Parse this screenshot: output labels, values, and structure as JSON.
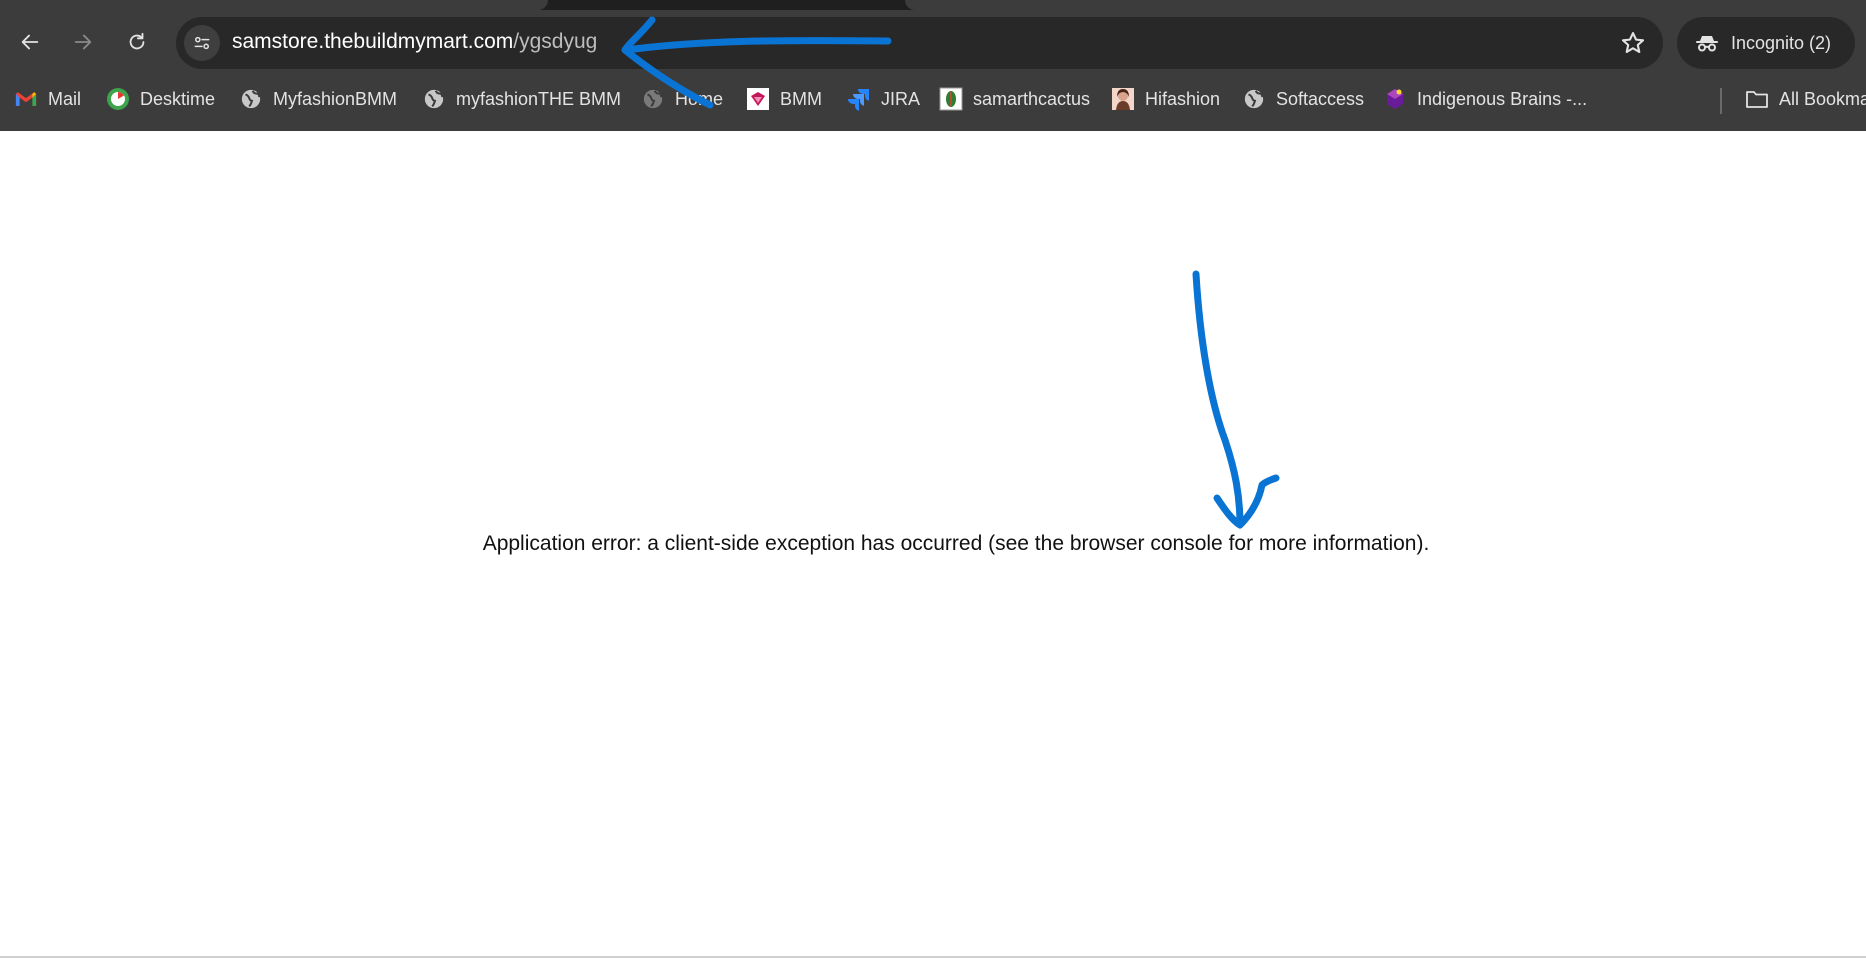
{
  "browser": {
    "address_bar": {
      "host": "samstore.thebuildmymart.com",
      "path": "/ygsdyug"
    },
    "profile_label": "Incognito (2)",
    "bookmarks": [
      {
        "label": "Mail",
        "icon": "gmail-icon"
      },
      {
        "label": "Desktime",
        "icon": "desktime-icon"
      },
      {
        "label": "MyfashionBMM",
        "icon": "globe-icon"
      },
      {
        "label": "myfashionTHE BMM",
        "icon": "globe-icon"
      },
      {
        "label": "Home",
        "icon": "globe-icon"
      },
      {
        "label": "BMM",
        "icon": "bmm-icon"
      },
      {
        "label": "JIRA",
        "icon": "jira-icon"
      },
      {
        "label": "samarthcactus",
        "icon": "cactus-icon"
      },
      {
        "label": "Hifashion",
        "icon": "hifashion-icon"
      },
      {
        "label": "Softaccess",
        "icon": "globe-icon"
      },
      {
        "label": "Indigenous Brains -...",
        "icon": "indigenous-brains-icon"
      }
    ],
    "all_bookmarks_label": "All Bookmarks"
  },
  "page": {
    "error_message": "Application error: a client-side exception has occurred (see the browser console for more information)."
  },
  "colors": {
    "chrome_bg": "#3c3c3c",
    "omnibox_bg": "#282828",
    "annotation": "#0a74d4"
  }
}
